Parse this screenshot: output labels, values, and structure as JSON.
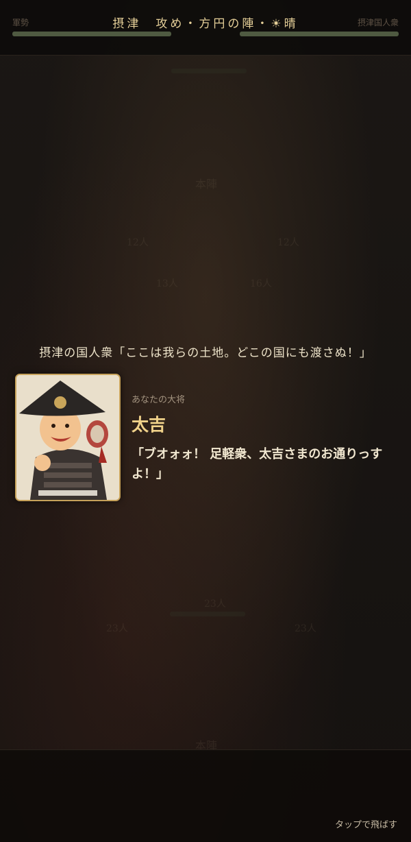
{
  "header": {
    "title": "摂津　攻め・方円の陣・☀晴",
    "left_label": "軍勢",
    "right_label": "摂津国人衆"
  },
  "dialog": {
    "enemy_line": "摂津の国人衆「ここは我らの土地。どこの国にも渡さぬ！」",
    "caption": "あなたの大将",
    "name": "太吉",
    "quote": "「ブオォォ！ 足軽衆、太吉さまのお通りっすよ！」"
  },
  "background_units": {
    "enemy_honjin": "本陣",
    "ally_honjin": "本陣",
    "counts": [
      "12人",
      "12人",
      "13人",
      "16人",
      "23人",
      "23人",
      "23人"
    ]
  },
  "footer": {
    "skip_label": "タップで飛ばす"
  }
}
